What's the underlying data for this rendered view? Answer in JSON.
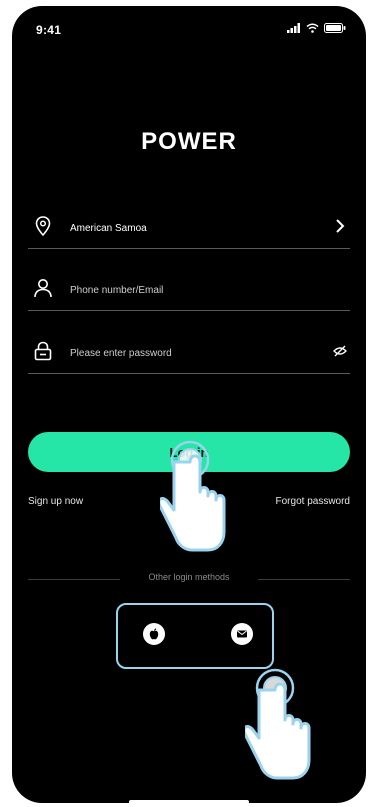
{
  "status_bar": {
    "time": "9:41"
  },
  "app": {
    "logo": "POWER"
  },
  "form": {
    "region": {
      "value": "American Samoa"
    },
    "account": {
      "placeholder": "Phone number/Email"
    },
    "password": {
      "placeholder": "Please enter password"
    }
  },
  "actions": {
    "login_label": "Log in",
    "sign_up_label": "Sign up now",
    "forgot_label": "Forgot password"
  },
  "other_login": {
    "label": "Other login methods",
    "methods": [
      "apple-icon",
      "mail-icon"
    ]
  },
  "colors": {
    "background": "#000000",
    "accent": "#25e6a6",
    "highlight_border": "#9bd3ee"
  }
}
